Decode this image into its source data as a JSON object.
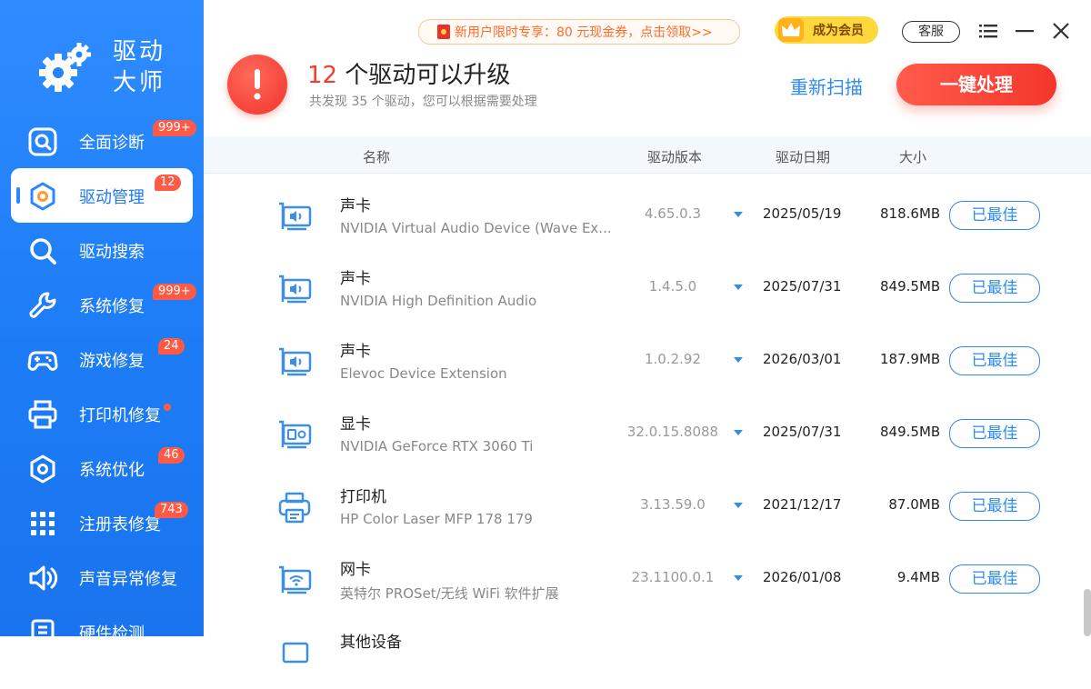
{
  "app": {
    "title_line1": "驱动",
    "title_line2": "大师"
  },
  "sidebar": {
    "items": [
      {
        "label": "全面诊断",
        "badge": "999+",
        "icon": "diagnose-icon"
      },
      {
        "label": "驱动管理",
        "badge": "12",
        "icon": "driver-manage-icon",
        "active": true
      },
      {
        "label": "驱动搜索",
        "badge": "",
        "icon": "search-icon"
      },
      {
        "label": "系统修复",
        "badge": "999+",
        "icon": "wrench-icon"
      },
      {
        "label": "游戏修复",
        "badge": "24",
        "icon": "gamepad-icon"
      },
      {
        "label": "打印机修复",
        "badge": "",
        "dot": true,
        "icon": "printer-icon"
      },
      {
        "label": "系统优化",
        "badge": "46",
        "icon": "optimize-icon"
      },
      {
        "label": "注册表修复",
        "badge": "743",
        "icon": "registry-grid-icon"
      },
      {
        "label": "声音异常修复",
        "badge": "",
        "icon": "speaker-icon"
      },
      {
        "label": "硬件检测",
        "badge": "",
        "icon": "hardware-icon"
      }
    ]
  },
  "header": {
    "promo": "新用户限时专享：80 元现金券，点击领取>>",
    "vip": "成为会员",
    "service": "客服"
  },
  "alert": {
    "count": "12",
    "title_rest": " 个驱动可以升级",
    "subtitle": "共发现 35 个驱动，您可以根据需要处理",
    "rescan": "重新扫描",
    "fix_all": "一键处理"
  },
  "table": {
    "headers": {
      "name": "名称",
      "version": "驱动版本",
      "date": "驱动日期",
      "size": "大小"
    },
    "rows": [
      {
        "category": "声卡",
        "name": "NVIDIA Virtual Audio Device (Wave Ex...",
        "version": "4.65.0.3",
        "date": "2025/05/19",
        "size": "818.6MB",
        "status": "已最佳",
        "icon": "sound-card-icon"
      },
      {
        "category": "声卡",
        "name": "NVIDIA High Definition Audio",
        "version": "1.4.5.0",
        "date": "2025/07/31",
        "size": "849.5MB",
        "status": "已最佳",
        "icon": "sound-card-icon"
      },
      {
        "category": "声卡",
        "name": "Elevoc Device Extension",
        "version": "1.0.2.92",
        "date": "2026/03/01",
        "size": "187.9MB",
        "status": "已最佳",
        "icon": "sound-card-icon"
      },
      {
        "category": "显卡",
        "name": "NVIDIA GeForce RTX 3060 Ti",
        "version": "32.0.15.8088",
        "date": "2025/07/31",
        "size": "849.5MB",
        "status": "已最佳",
        "icon": "graphics-card-icon"
      },
      {
        "category": "打印机",
        "name": "HP Color Laser MFP 178 179",
        "version": "3.13.59.0",
        "date": "2021/12/17",
        "size": "87.0MB",
        "status": "已最佳",
        "icon": "printer-icon"
      },
      {
        "category": "网卡",
        "name": "英特尔 PROSet/无线 WiFi 软件扩展",
        "version": "23.1100.0.1",
        "date": "2026/01/08",
        "size": "9.4MB",
        "status": "已最佳",
        "icon": "network-card-icon"
      },
      {
        "category": "其他设备",
        "name": "",
        "version": "",
        "date": "",
        "size": "",
        "status": "",
        "icon": "other-device-icon"
      }
    ]
  },
  "colors": {
    "sidebar": "#1c7cf6",
    "accent": "#2e8bf0",
    "danger": "#f53b2e",
    "badge": "#ff5a45"
  }
}
